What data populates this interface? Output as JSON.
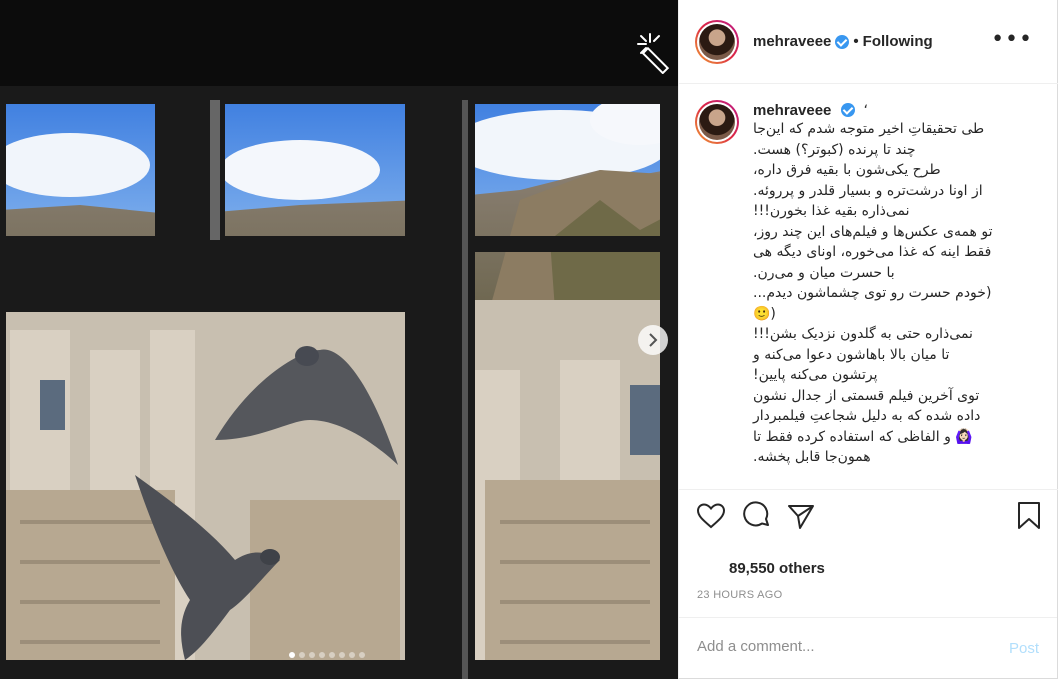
{
  "post": {
    "username": "mehraveee",
    "follow_status": "Following",
    "more_icon": "more-horizontal-icon",
    "caption_username": "mehraveee",
    "caption_suffix": "‘",
    "caption_lines": [
      "طی تحقیقاتِ اخیر متوجه شدم که این‌جا",
      "چند تا پرنده (کبوتر؟) هست.",
      "طرح یکی‌شون با بقیه فرق داره،",
      "از اونا درشت‌تره و بسیار قلدر و پررو‌ئه.",
      "نمی‌ذاره بقیه غذا بخورن!!!",
      "تو همه‌ی عکس‌ها و فیلم‌های این چند روز،",
      "فقط اینه که غذا می‌خوره، اونای دیگه هی",
      "با حسرت میان و می‌رن.",
      "(خودم حسرت رو توی چشماشون دیدم...",
      "🙂)",
      "نمی‌ذاره حتی به گلدون نزدیک بشن!!!",
      "تا میان بالا باهاشون دعوا می‌کنه و",
      "پرتشون می‌کنه پایین!",
      "توی آخرین فیلم قسمتی از جدال نشون",
      "داده شده که به دلیل شجاعتِ فیلمبردار",
      "🙆🏻‍♀️ و الفاظی که استفاده کرده فقط تا",
      "همون‌جا قابل پخشه."
    ],
    "likes_text": "89,550 others",
    "timestamp": "23 HOURS AGO",
    "comment": {
      "placeholder": "Add a comment...",
      "post_label": "Post"
    }
  },
  "carousel": {
    "slide_count": 8,
    "active_index": 0
  },
  "colors": {
    "verified": "#3897f0",
    "post_disabled": "#b2dffc",
    "meta": "#8e8e8e"
  }
}
